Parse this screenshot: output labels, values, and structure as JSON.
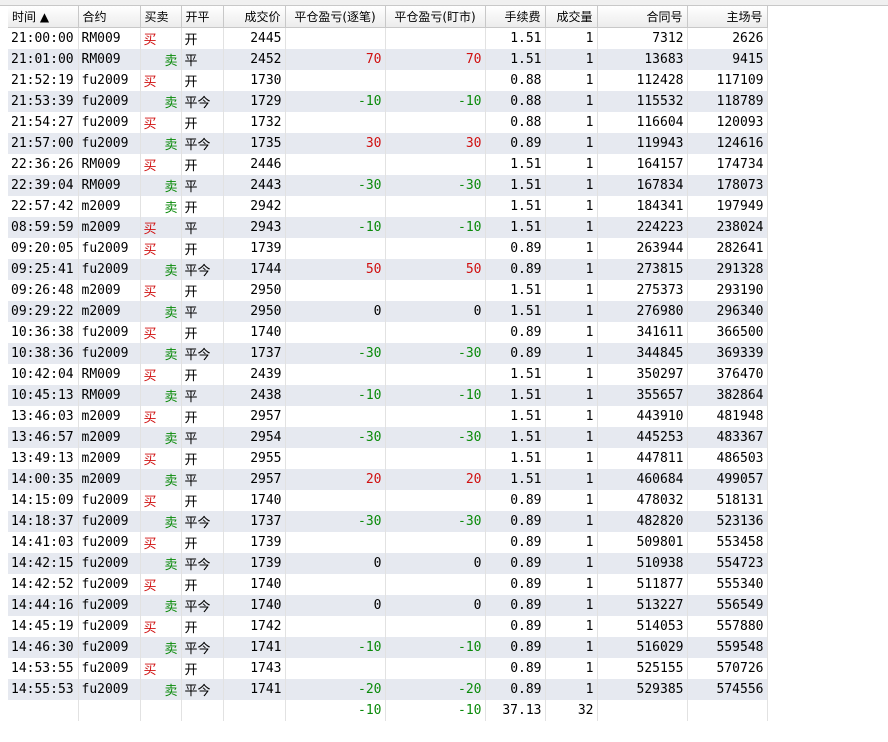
{
  "top_strip_text": "",
  "columns": [
    {
      "label": "时间 ▲",
      "align": "l"
    },
    {
      "label": "合约",
      "align": "l"
    },
    {
      "label": "买卖",
      "align": "l"
    },
    {
      "label": "开平",
      "align": "l"
    },
    {
      "label": "成交价",
      "align": "r"
    },
    {
      "label": "平仓盈亏(逐笔)",
      "align": "c"
    },
    {
      "label": "平仓盈亏(盯市)",
      "align": "c"
    },
    {
      "label": "手续费",
      "align": "r"
    },
    {
      "label": "成交量",
      "align": "r"
    },
    {
      "label": "合同号",
      "align": "r"
    },
    {
      "label": "主场号",
      "align": "r"
    }
  ],
  "rows": [
    {
      "time": "21:00:00",
      "contract": "RM009",
      "side": "买",
      "oc": "开",
      "price": "2445",
      "pnl_trade": "",
      "pnl_mark": "",
      "fee": "1.51",
      "qty": "1",
      "contract_no": "7312",
      "exch_no": "2626"
    },
    {
      "time": "21:01:00",
      "contract": "RM009",
      "side": "卖",
      "oc": "平",
      "price": "2452",
      "pnl_trade": "70",
      "pnl_mark": "70",
      "fee": "1.51",
      "qty": "1",
      "contract_no": "13683",
      "exch_no": "9415"
    },
    {
      "time": "21:52:19",
      "contract": "fu2009",
      "side": "买",
      "oc": "开",
      "price": "1730",
      "pnl_trade": "",
      "pnl_mark": "",
      "fee": "0.88",
      "qty": "1",
      "contract_no": "112428",
      "exch_no": "117109"
    },
    {
      "time": "21:53:39",
      "contract": "fu2009",
      "side": "卖",
      "oc": "平今",
      "price": "1729",
      "pnl_trade": "-10",
      "pnl_mark": "-10",
      "fee": "0.88",
      "qty": "1",
      "contract_no": "115532",
      "exch_no": "118789"
    },
    {
      "time": "21:54:27",
      "contract": "fu2009",
      "side": "买",
      "oc": "开",
      "price": "1732",
      "pnl_trade": "",
      "pnl_mark": "",
      "fee": "0.88",
      "qty": "1",
      "contract_no": "116604",
      "exch_no": "120093"
    },
    {
      "time": "21:57:00",
      "contract": "fu2009",
      "side": "卖",
      "oc": "平今",
      "price": "1735",
      "pnl_trade": "30",
      "pnl_mark": "30",
      "fee": "0.89",
      "qty": "1",
      "contract_no": "119943",
      "exch_no": "124616"
    },
    {
      "time": "22:36:26",
      "contract": "RM009",
      "side": "买",
      "oc": "开",
      "price": "2446",
      "pnl_trade": "",
      "pnl_mark": "",
      "fee": "1.51",
      "qty": "1",
      "contract_no": "164157",
      "exch_no": "174734"
    },
    {
      "time": "22:39:04",
      "contract": "RM009",
      "side": "卖",
      "oc": "平",
      "price": "2443",
      "pnl_trade": "-30",
      "pnl_mark": "-30",
      "fee": "1.51",
      "qty": "1",
      "contract_no": "167834",
      "exch_no": "178073"
    },
    {
      "time": "22:57:42",
      "contract": "m2009",
      "side": "卖",
      "oc": "开",
      "price": "2942",
      "pnl_trade": "",
      "pnl_mark": "",
      "fee": "1.51",
      "qty": "1",
      "contract_no": "184341",
      "exch_no": "197949"
    },
    {
      "time": "08:59:59",
      "contract": "m2009",
      "side": "买",
      "oc": "平",
      "price": "2943",
      "pnl_trade": "-10",
      "pnl_mark": "-10",
      "fee": "1.51",
      "qty": "1",
      "contract_no": "224223",
      "exch_no": "238024"
    },
    {
      "time": "09:20:05",
      "contract": "fu2009",
      "side": "买",
      "oc": "开",
      "price": "1739",
      "pnl_trade": "",
      "pnl_mark": "",
      "fee": "0.89",
      "qty": "1",
      "contract_no": "263944",
      "exch_no": "282641"
    },
    {
      "time": "09:25:41",
      "contract": "fu2009",
      "side": "卖",
      "oc": "平今",
      "price": "1744",
      "pnl_trade": "50",
      "pnl_mark": "50",
      "fee": "0.89",
      "qty": "1",
      "contract_no": "273815",
      "exch_no": "291328"
    },
    {
      "time": "09:26:48",
      "contract": "m2009",
      "side": "买",
      "oc": "开",
      "price": "2950",
      "pnl_trade": "",
      "pnl_mark": "",
      "fee": "1.51",
      "qty": "1",
      "contract_no": "275373",
      "exch_no": "293190"
    },
    {
      "time": "09:29:22",
      "contract": "m2009",
      "side": "卖",
      "oc": "平",
      "price": "2950",
      "pnl_trade": "0",
      "pnl_mark": "0",
      "fee": "1.51",
      "qty": "1",
      "contract_no": "276980",
      "exch_no": "296340"
    },
    {
      "time": "10:36:38",
      "contract": "fu2009",
      "side": "买",
      "oc": "开",
      "price": "1740",
      "pnl_trade": "",
      "pnl_mark": "",
      "fee": "0.89",
      "qty": "1",
      "contract_no": "341611",
      "exch_no": "366500"
    },
    {
      "time": "10:38:36",
      "contract": "fu2009",
      "side": "卖",
      "oc": "平今",
      "price": "1737",
      "pnl_trade": "-30",
      "pnl_mark": "-30",
      "fee": "0.89",
      "qty": "1",
      "contract_no": "344845",
      "exch_no": "369339"
    },
    {
      "time": "10:42:04",
      "contract": "RM009",
      "side": "买",
      "oc": "开",
      "price": "2439",
      "pnl_trade": "",
      "pnl_mark": "",
      "fee": "1.51",
      "qty": "1",
      "contract_no": "350297",
      "exch_no": "376470"
    },
    {
      "time": "10:45:13",
      "contract": "RM009",
      "side": "卖",
      "oc": "平",
      "price": "2438",
      "pnl_trade": "-10",
      "pnl_mark": "-10",
      "fee": "1.51",
      "qty": "1",
      "contract_no": "355657",
      "exch_no": "382864"
    },
    {
      "time": "13:46:03",
      "contract": "m2009",
      "side": "买",
      "oc": "开",
      "price": "2957",
      "pnl_trade": "",
      "pnl_mark": "",
      "fee": "1.51",
      "qty": "1",
      "contract_no": "443910",
      "exch_no": "481948"
    },
    {
      "time": "13:46:57",
      "contract": "m2009",
      "side": "卖",
      "oc": "平",
      "price": "2954",
      "pnl_trade": "-30",
      "pnl_mark": "-30",
      "fee": "1.51",
      "qty": "1",
      "contract_no": "445253",
      "exch_no": "483367"
    },
    {
      "time": "13:49:13",
      "contract": "m2009",
      "side": "买",
      "oc": "开",
      "price": "2955",
      "pnl_trade": "",
      "pnl_mark": "",
      "fee": "1.51",
      "qty": "1",
      "contract_no": "447811",
      "exch_no": "486503"
    },
    {
      "time": "14:00:35",
      "contract": "m2009",
      "side": "卖",
      "oc": "平",
      "price": "2957",
      "pnl_trade": "20",
      "pnl_mark": "20",
      "fee": "1.51",
      "qty": "1",
      "contract_no": "460684",
      "exch_no": "499057"
    },
    {
      "time": "14:15:09",
      "contract": "fu2009",
      "side": "买",
      "oc": "开",
      "price": "1740",
      "pnl_trade": "",
      "pnl_mark": "",
      "fee": "0.89",
      "qty": "1",
      "contract_no": "478032",
      "exch_no": "518131"
    },
    {
      "time": "14:18:37",
      "contract": "fu2009",
      "side": "卖",
      "oc": "平今",
      "price": "1737",
      "pnl_trade": "-30",
      "pnl_mark": "-30",
      "fee": "0.89",
      "qty": "1",
      "contract_no": "482820",
      "exch_no": "523136"
    },
    {
      "time": "14:41:03",
      "contract": "fu2009",
      "side": "买",
      "oc": "开",
      "price": "1739",
      "pnl_trade": "",
      "pnl_mark": "",
      "fee": "0.89",
      "qty": "1",
      "contract_no": "509801",
      "exch_no": "553458"
    },
    {
      "time": "14:42:15",
      "contract": "fu2009",
      "side": "卖",
      "oc": "平今",
      "price": "1739",
      "pnl_trade": "0",
      "pnl_mark": "0",
      "fee": "0.89",
      "qty": "1",
      "contract_no": "510938",
      "exch_no": "554723"
    },
    {
      "time": "14:42:52",
      "contract": "fu2009",
      "side": "买",
      "oc": "开",
      "price": "1740",
      "pnl_trade": "",
      "pnl_mark": "",
      "fee": "0.89",
      "qty": "1",
      "contract_no": "511877",
      "exch_no": "555340"
    },
    {
      "time": "14:44:16",
      "contract": "fu2009",
      "side": "卖",
      "oc": "平今",
      "price": "1740",
      "pnl_trade": "0",
      "pnl_mark": "0",
      "fee": "0.89",
      "qty": "1",
      "contract_no": "513227",
      "exch_no": "556549"
    },
    {
      "time": "14:45:19",
      "contract": "fu2009",
      "side": "买",
      "oc": "开",
      "price": "1742",
      "pnl_trade": "",
      "pnl_mark": "",
      "fee": "0.89",
      "qty": "1",
      "contract_no": "514053",
      "exch_no": "557880"
    },
    {
      "time": "14:46:30",
      "contract": "fu2009",
      "side": "卖",
      "oc": "平今",
      "price": "1741",
      "pnl_trade": "-10",
      "pnl_mark": "-10",
      "fee": "0.89",
      "qty": "1",
      "contract_no": "516029",
      "exch_no": "559548"
    },
    {
      "time": "14:53:55",
      "contract": "fu2009",
      "side": "买",
      "oc": "开",
      "price": "1743",
      "pnl_trade": "",
      "pnl_mark": "",
      "fee": "0.89",
      "qty": "1",
      "contract_no": "525155",
      "exch_no": "570726"
    },
    {
      "time": "14:55:53",
      "contract": "fu2009",
      "side": "卖",
      "oc": "平今",
      "price": "1741",
      "pnl_trade": "-20",
      "pnl_mark": "-20",
      "fee": "0.89",
      "qty": "1",
      "contract_no": "529385",
      "exch_no": "574556"
    }
  ],
  "totals": {
    "pnl_trade": "-10",
    "pnl_mark": "-10",
    "fee": "37.13",
    "qty": "32"
  },
  "colors": {
    "buy": "#d01010",
    "sell": "#0a8a0a",
    "row_alt": "#e6e9f0"
  }
}
